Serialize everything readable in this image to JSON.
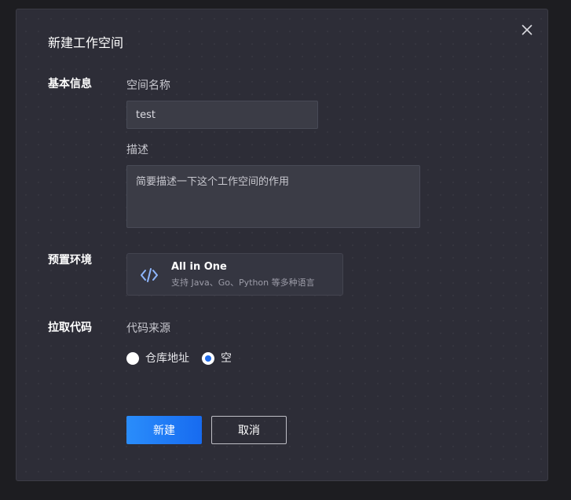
{
  "dialog": {
    "title": "新建工作空间",
    "close_icon": "close-icon"
  },
  "basic_info": {
    "section_label": "基本信息",
    "name_label": "空间名称",
    "name_value": "test",
    "desc_label": "描述",
    "desc_placeholder": "简要描述一下这个工作空间的作用"
  },
  "environment": {
    "section_label": "预置环境",
    "card": {
      "icon": "code-brackets-icon",
      "name": "All in One",
      "description": "支持 Java、Go、Python 等多种语言"
    }
  },
  "pull_code": {
    "section_label": "拉取代码",
    "source_label": "代码来源",
    "options": [
      {
        "label": "仓库地址",
        "checked": false
      },
      {
        "label": "空",
        "checked": true
      }
    ]
  },
  "actions": {
    "create_label": "新建",
    "cancel_label": "取消"
  },
  "colors": {
    "background": "#1d1d21",
    "dialog": "#2d2d37",
    "primary": "#1f6ae8",
    "icon_accent": "#8fb7ff"
  }
}
